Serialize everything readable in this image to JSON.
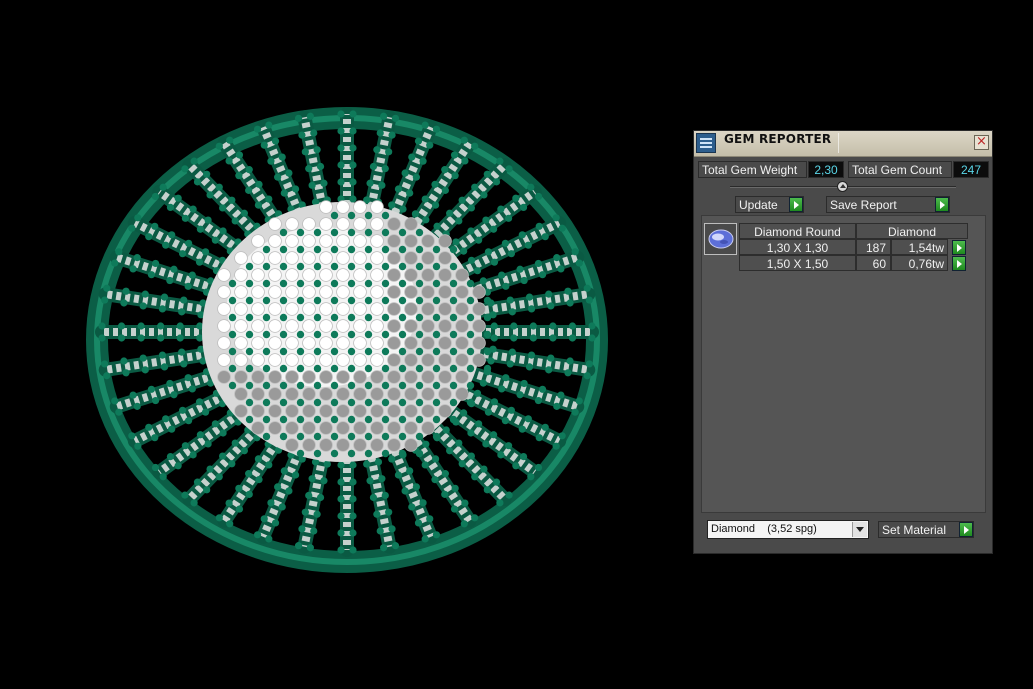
{
  "window": {
    "title": "GEM REPORTER",
    "close_symbol": "×"
  },
  "summary": {
    "weight_label": "Total Gem Weight",
    "weight_value": "2,30",
    "count_label": "Total Gem Count",
    "count_value": "247"
  },
  "actions": {
    "update_label": "Update",
    "save_label": "Save Report"
  },
  "table": {
    "headers": [
      "Diamond Round",
      "Diamond"
    ],
    "rows": [
      {
        "size": "1,30 X 1,30",
        "count": "187",
        "weight": "1,54tw"
      },
      {
        "size": "1,50 X 1,50",
        "count": "60",
        "weight": "0,76tw"
      }
    ]
  },
  "material": {
    "selected": "Diamond    (3,52 spg)",
    "set_label": "Set Material"
  },
  "colors": {
    "metal": "#0e7a5a",
    "stone": "#ffffff",
    "value_text": "#5ad6e8",
    "go_button": "#2fa12f"
  },
  "icons": {
    "app": "gem-reporter-app-icon",
    "close": "close-icon",
    "go": "green-arrow-icon",
    "collapse": "collapse-knob-icon",
    "gem": "round-gem-icon",
    "dropdown": "chevron-down-icon"
  }
}
